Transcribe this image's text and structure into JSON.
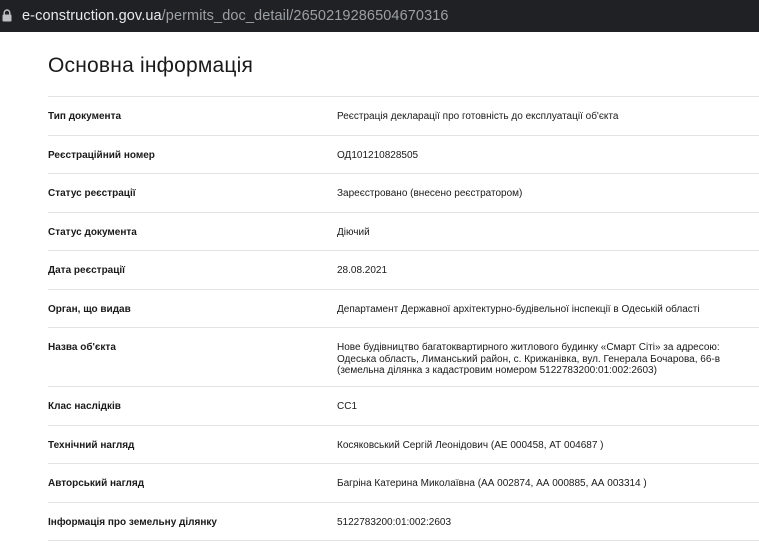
{
  "browser": {
    "url_domain": "e-construction.gov.ua",
    "url_path": "/permits_doc_detail/2650219286504670316"
  },
  "page": {
    "title": "Основна інформація"
  },
  "info": [
    {
      "label": "Тип документа",
      "value": "Реєстрація декларації про готовність до експлуатації об'єкта"
    },
    {
      "label": "Реєстраційний номер",
      "value": "ОД101210828505"
    },
    {
      "label": "Статус реєстрації",
      "value": "Зареєстровано (внесено реєстратором)"
    },
    {
      "label": "Статус документа",
      "value": "Діючий"
    },
    {
      "label": "Дата реєстрації",
      "value": "28.08.2021"
    },
    {
      "label": "Орган, що видав",
      "value": "Департамент Державної архітектурно-будівельної інспекції в Одеській області"
    },
    {
      "label": "Назва об'єкта",
      "value": "Нове будівництво багатоквартирного житлового будинку «Смарт Сіті» за адресою: Одеська область, Лиманський район, с. Крижанівка, вул. Генерала Бочарова, 66-в (земельна ділянка з кадастровим номером 5122783200:01:002:2603)"
    },
    {
      "label": "Клас наслідків",
      "value": "СС1"
    },
    {
      "label": "Технічний нагляд",
      "value": "Косяковський Сергій Леонідович (АЕ 000458, АТ 004687 )"
    },
    {
      "label": "Авторський нагляд",
      "value": "Багріна Катерина Миколаївна (АА 002874, АА 000885, АА 003314 )"
    },
    {
      "label": "Інформація про земельну ділянку",
      "value": "5122783200:01:002:2603"
    }
  ]
}
